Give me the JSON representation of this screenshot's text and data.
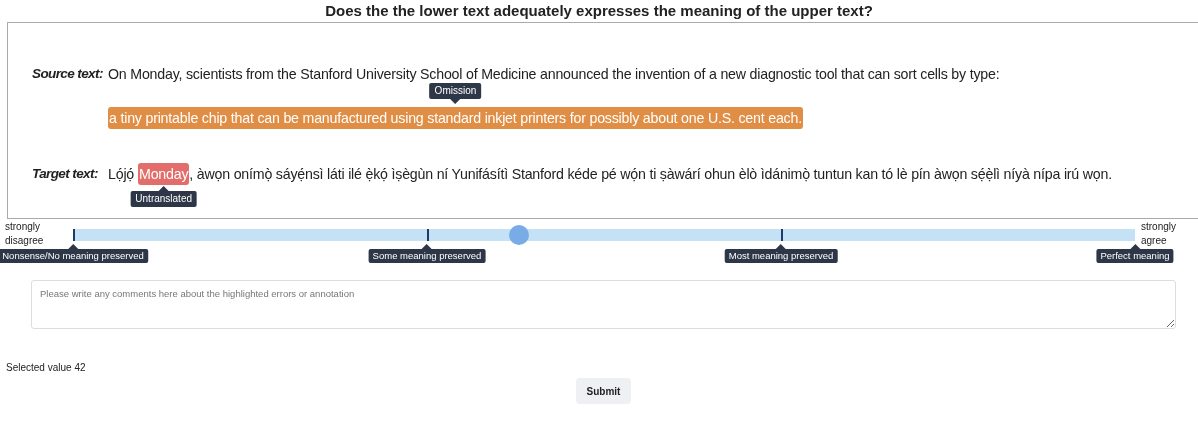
{
  "question": "Does the the lower text adequately expresses the meaning of the upper text?",
  "source": {
    "label": "Source text:",
    "lines": [
      [
        {
          "kind": "plain",
          "text": "On Monday, scientists from the Stanford University School of Medicine announced the invention of a new diagnostic tool that can sort cells by type:"
        }
      ],
      [
        {
          "kind": "error",
          "text": "a tiny printable chip that can be manufactured using standard inkjet printers for possibly about one U.S. cent each.",
          "tag": "Omission",
          "color": "#e08e45"
        }
      ]
    ]
  },
  "target": {
    "label": "Target text:",
    "lines": [
      [
        {
          "kind": "plain",
          "text": "Lọ́jọ́"
        },
        {
          "kind": "error",
          "text": "Monday",
          "tag": "Untranslated",
          "color": "#e26d6a"
        },
        {
          "kind": "plain",
          "text": ", àwọn onímọ̀ sáyẹ́nsì láti ilé ẹ̀kọ́ ìṣègùn ní Yunifásítì Stanford kéde pé wọ́n ti ṣàwárí ohun èlò ìdánimọ̀ tuntun kan tó lè pín àwọn sẹ́ẹ̀lì níyà nípa irú wọn."
        }
      ]
    ]
  },
  "scale": {
    "left_label": "strongly disagree",
    "right_label": "strongly agree",
    "level": 0.42,
    "labels": [
      "Nonsense/No meaning preserved",
      "Some meaning preserved",
      "Most meaning preserved",
      "Perfect meaning"
    ]
  },
  "comments": {
    "placeholder": "Please write any comments here about the highlighted errors or annotation"
  },
  "selected_value": "Selected value 42",
  "submit": "Submit"
}
